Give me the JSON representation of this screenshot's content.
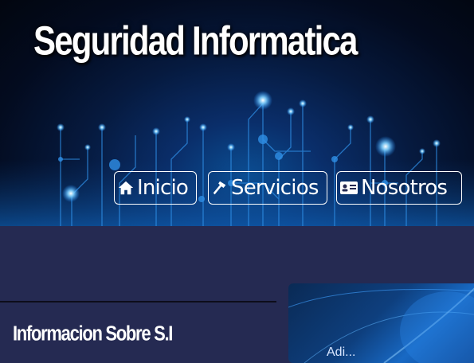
{
  "header": {
    "title": "Seguridad Informatica"
  },
  "nav": {
    "items": [
      {
        "label": "Inicio",
        "icon": "home-icon"
      },
      {
        "label": "Servicios",
        "icon": "hammer-icon"
      },
      {
        "label": "Nosotros",
        "icon": "id-card-icon"
      }
    ]
  },
  "main": {
    "section_title": "Informacion Sobre S.I",
    "image_caption_partial": "Adi..."
  },
  "colors": {
    "page_background": "#252a52",
    "hero_glow": "#1e8fff",
    "text": "#ffffff"
  }
}
